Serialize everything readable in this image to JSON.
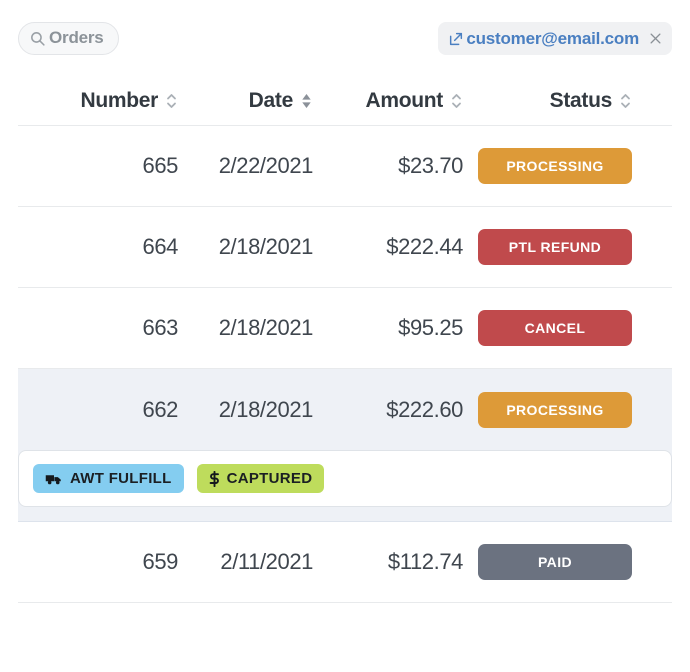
{
  "filter_bar": {
    "search_pill": {
      "label": "Orders",
      "icon": "search-icon"
    },
    "email_tag": {
      "text": "customer@email.com",
      "external_icon": "external-link-icon",
      "close_icon": "close-icon",
      "color": "#4a7fc1"
    }
  },
  "table": {
    "columns": [
      {
        "label": "Number",
        "sort": "inactive"
      },
      {
        "label": "Date",
        "sort": "active"
      },
      {
        "label": "Amount",
        "sort": "inactive"
      },
      {
        "label": "Status",
        "sort": "inactive"
      }
    ],
    "rows": [
      {
        "number": "665",
        "date": "2/22/2021",
        "amount": "$23.70",
        "status": "PROCESSING",
        "status_color": "#dd9a38",
        "selected": false
      },
      {
        "number": "664",
        "date": "2/18/2021",
        "amount": "$222.44",
        "status": "PTL REFUND",
        "status_color": "#c04a4c",
        "selected": false
      },
      {
        "number": "663",
        "date": "2/18/2021",
        "amount": "$95.25",
        "status": "CANCEL",
        "status_color": "#c04a4c",
        "selected": false
      },
      {
        "number": "662",
        "date": "2/18/2021",
        "amount": "$222.60",
        "status": "PROCESSING",
        "status_color": "#dd9a38",
        "selected": true,
        "detail_chips": [
          {
            "label": "AWT FULFILL",
            "icon": "truck-icon",
            "color": "#84cdf0"
          },
          {
            "label": "CAPTURED",
            "icon": "dollar-icon",
            "color": "#bedc5c"
          }
        ]
      },
      {
        "number": "659",
        "date": "2/11/2021",
        "amount": "$112.74",
        "status": "PAID",
        "status_color": "#6b7280",
        "selected": false
      }
    ]
  }
}
